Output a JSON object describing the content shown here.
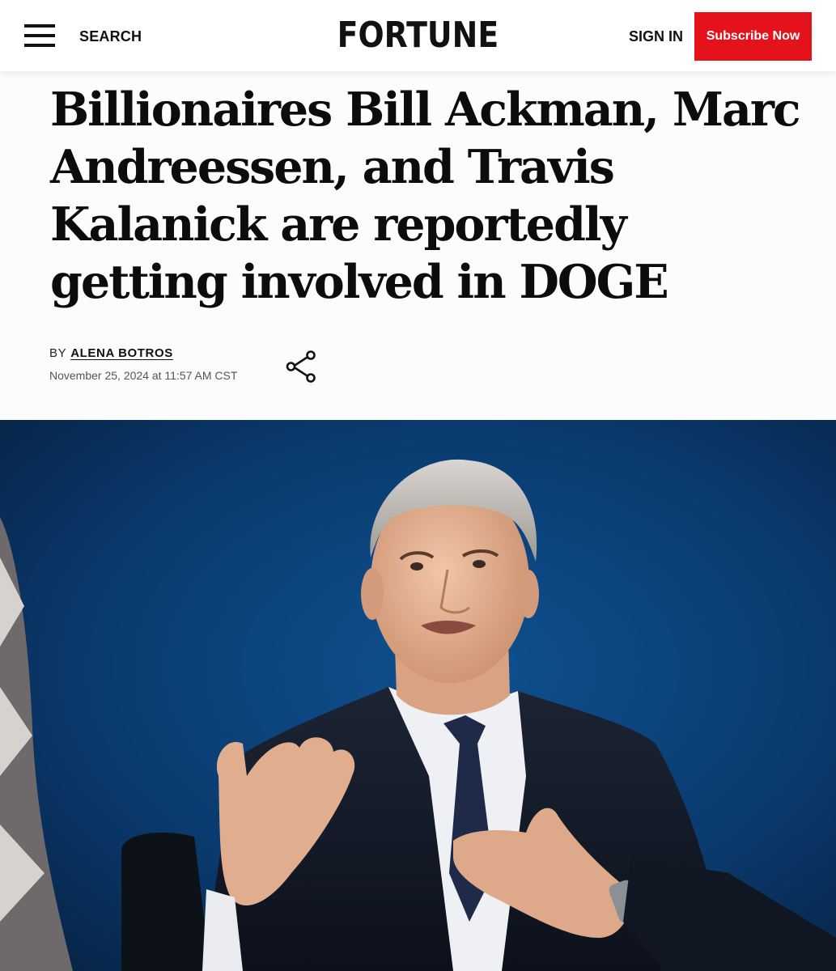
{
  "header": {
    "menu_icon": "hamburger-menu-icon",
    "search_label": "SEARCH",
    "logo_text": "FORTUNE",
    "signin_label": "SIGN IN",
    "subscribe_label": "Subscribe Now",
    "subscribe_color": "#e3121b"
  },
  "article": {
    "headline": "Billionaires Bill Ackman, Marc Andreessen, and Travis Kalanick are reportedly getting involved in DOGE",
    "byline_prefix": "BY",
    "author": "ALENA BOTROS",
    "date": "November 25, 2024 at 11:57 AM CST",
    "share_icon": "share-icon",
    "hero_image_background": "#0a3764"
  }
}
